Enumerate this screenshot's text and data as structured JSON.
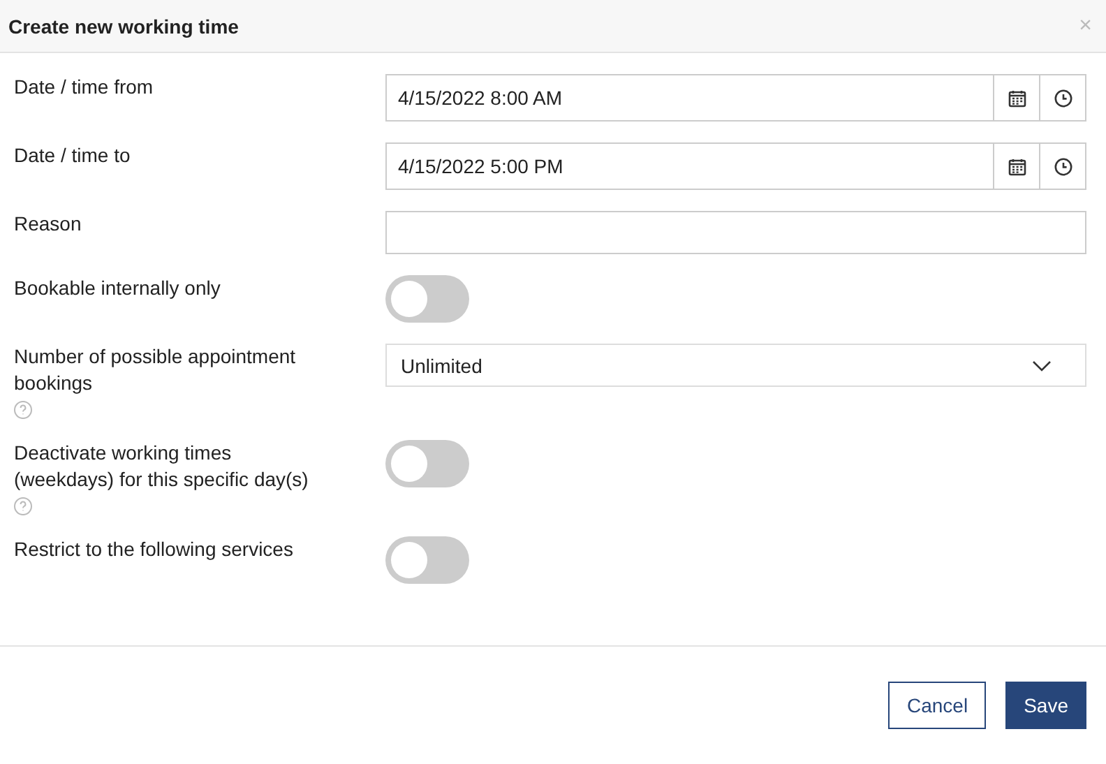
{
  "dialog": {
    "title": "Create new working time",
    "close": "×"
  },
  "rows": [
    {
      "kind": "datetime",
      "label": "Date / time from",
      "value": "4/15/2022 8:00 AM"
    },
    {
      "kind": "datetime",
      "label": "Date / time to",
      "value": "4/15/2022 5:00 PM"
    },
    {
      "kind": "text",
      "label": "Reason"
    },
    {
      "kind": "toggle",
      "label": "Bookable internally only",
      "on": false
    },
    {
      "kind": "select",
      "label": "Number of possible appointment bookings",
      "help": true,
      "value": "Unlimited"
    },
    {
      "kind": "toggle",
      "label": "Deactivate working times (weekdays) for this specific day(s)",
      "help": true,
      "on": false
    },
    {
      "kind": "toggle",
      "label": "Restrict to the following services",
      "on": false
    }
  ],
  "buttons": [
    {
      "label": "Cancel",
      "primary": false
    },
    {
      "label": "Save",
      "primary": true
    }
  ]
}
